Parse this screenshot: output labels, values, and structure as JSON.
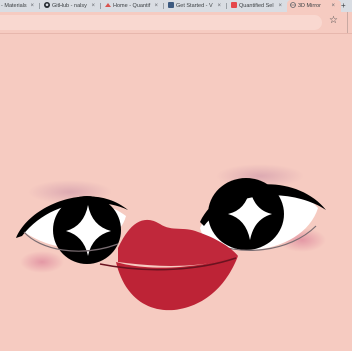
{
  "browser": {
    "tabs": [
      {
        "label": "- Materials",
        "favicon": "generic-icon"
      },
      {
        "label": "GitHub - nalsy",
        "favicon": "github-icon"
      },
      {
        "label": "Home - Quantif",
        "favicon": "quantified-icon"
      },
      {
        "label": "Get Started - V",
        "favicon": "docs-icon"
      },
      {
        "label": "Quantified Sel",
        "favicon": "quantified-self-icon"
      },
      {
        "label": "3D Mirror",
        "favicon": "globe-icon"
      }
    ],
    "tab_close_glyph": "×",
    "new_tab_glyph": "+",
    "bookmark_glyph": "☆"
  },
  "colors": {
    "background": "#f6cbc1",
    "lips": "#c0283b",
    "eye_white": "#ffffff",
    "iris": "#000000",
    "blush": "#e59aa6"
  }
}
